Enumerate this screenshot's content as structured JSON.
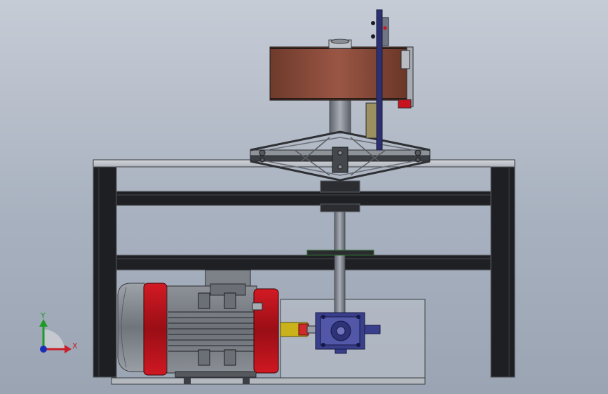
{
  "viewport": {
    "background_top": "#c6ccd6",
    "background_bottom": "#9aa4b3"
  },
  "triad": {
    "x_label": "X",
    "y_label": "Y",
    "x_color": "#c8202a",
    "y_color": "#1f9a2a",
    "z_color": "#1a2fb8"
  },
  "colors": {
    "frame": "#1e1f22",
    "frame_edge": "#4a4d52",
    "drum": "#8a4a3a",
    "motor_red": "#c8141e",
    "motor_body": "#7b7f86",
    "gearbox": "#3a3f8c",
    "coupling": "#c9b21a",
    "glass_panel": "#b9bec7"
  },
  "components": [
    "drum",
    "shaft",
    "truss",
    "frame",
    "motor",
    "coupling",
    "gearbox",
    "triad"
  ]
}
